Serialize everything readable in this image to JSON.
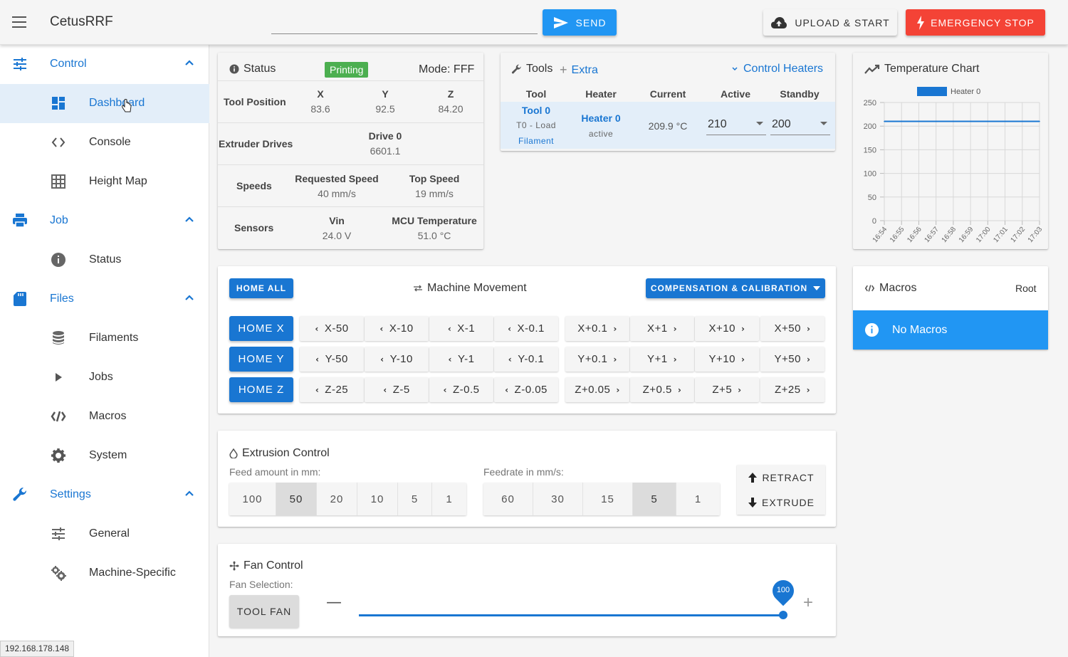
{
  "app": {
    "title": "CetusRRF"
  },
  "topbar": {
    "code_placeholder": "",
    "send_label": "Send",
    "upload_label": "Upload & Start",
    "estop_label": "Emergency Stop"
  },
  "sidebar": {
    "groups": [
      {
        "label": "Control",
        "items": [
          "Dashboard",
          "Console",
          "Height Map"
        ]
      },
      {
        "label": "Job",
        "items": [
          "Status"
        ]
      },
      {
        "label": "Files",
        "items": [
          "Filaments",
          "Jobs",
          "Macros",
          "System"
        ]
      },
      {
        "label": "Settings",
        "items": [
          "General",
          "Machine-Specific"
        ]
      }
    ],
    "active_item": "Dashboard"
  },
  "status_bar_url": "192.168.178.148",
  "status": {
    "title": "Status",
    "state": "Printing",
    "mode": "Mode: FFF",
    "tool_position_label": "Tool Position",
    "axes": [
      {
        "name": "X",
        "value": "83.6"
      },
      {
        "name": "Y",
        "value": "92.5"
      },
      {
        "name": "Z",
        "value": "84.20"
      }
    ],
    "extruder_label": "Extruder Drives",
    "drive_name": "Drive 0",
    "drive_value": "6601.1",
    "speeds_label": "Speeds",
    "requested_speed_label": "Requested Speed",
    "requested_speed": "40 mm/s",
    "top_speed_label": "Top Speed",
    "top_speed": "19 mm/s",
    "sensors_label": "Sensors",
    "vin_label": "Vin",
    "vin": "24.0 V",
    "mcu_label": "MCU Temperature",
    "mcu": "51.0 °C"
  },
  "tools": {
    "title": "Tools",
    "extra_label": "Extra",
    "control_heaters_label": "Control Heaters",
    "headers": [
      "Tool",
      "Heater",
      "Current",
      "Active",
      "Standby"
    ],
    "row": {
      "tool": "Tool 0",
      "tool_sub1": "T0 - Load",
      "tool_sub2": "Filament",
      "heater": "Heater 0",
      "heater_state": "active",
      "current": "209.9 °C",
      "active": "210",
      "standby": "200"
    }
  },
  "chart": {
    "title": "Temperature Chart"
  },
  "chart_data": {
    "type": "line",
    "title": "",
    "legend": [
      "Heater 0"
    ],
    "legend_placement": "top",
    "x": [
      "16:54",
      "16:55",
      "16:56",
      "16:57",
      "16:58",
      "16:59",
      "17:00",
      "17:01",
      "17:02",
      "17:03"
    ],
    "series": [
      {
        "name": "Heater 0",
        "values": [
          210,
          210,
          210,
          210,
          210,
          210,
          210,
          210,
          210,
          210
        ],
        "color": "#1976d2"
      }
    ],
    "yticks": [
      0,
      50,
      100,
      150,
      200,
      250
    ],
    "ylim": [
      0,
      250
    ],
    "grid": true
  },
  "movement": {
    "title": "Machine Movement",
    "home_all": "Home All",
    "compensation": "Compensation & Calibration",
    "rows": [
      {
        "home": "Home X",
        "minus": [
          "X-50",
          "X-10",
          "X-1",
          "X-0.1"
        ],
        "plus": [
          "X+0.1",
          "X+1",
          "X+10",
          "X+50"
        ]
      },
      {
        "home": "Home Y",
        "minus": [
          "Y-50",
          "Y-10",
          "Y-1",
          "Y-0.1"
        ],
        "plus": [
          "Y+0.1",
          "Y+1",
          "Y+10",
          "Y+50"
        ]
      },
      {
        "home": "Home Z",
        "minus": [
          "Z-25",
          "Z-5",
          "Z-0.5",
          "Z-0.05"
        ],
        "plus": [
          "Z+0.05",
          "Z+0.5",
          "Z+5",
          "Z+25"
        ]
      }
    ]
  },
  "macros": {
    "title": "Macros",
    "root": "Root",
    "empty": "No Macros"
  },
  "extrusion": {
    "title": "Extrusion Control",
    "feed_label": "Feed amount in mm:",
    "feed_options": [
      "100",
      "50",
      "20",
      "10",
      "5",
      "1"
    ],
    "feed_selected": "50",
    "rate_label": "Feedrate in mm/s:",
    "rate_options": [
      "60",
      "30",
      "15",
      "5",
      "1"
    ],
    "rate_selected": "5",
    "retract": "Retract",
    "extrude": "Extrude"
  },
  "fan": {
    "title": "Fan Control",
    "selection_label": "Fan Selection:",
    "fan_name": "Tool Fan",
    "value": "100",
    "level": 1.0
  }
}
